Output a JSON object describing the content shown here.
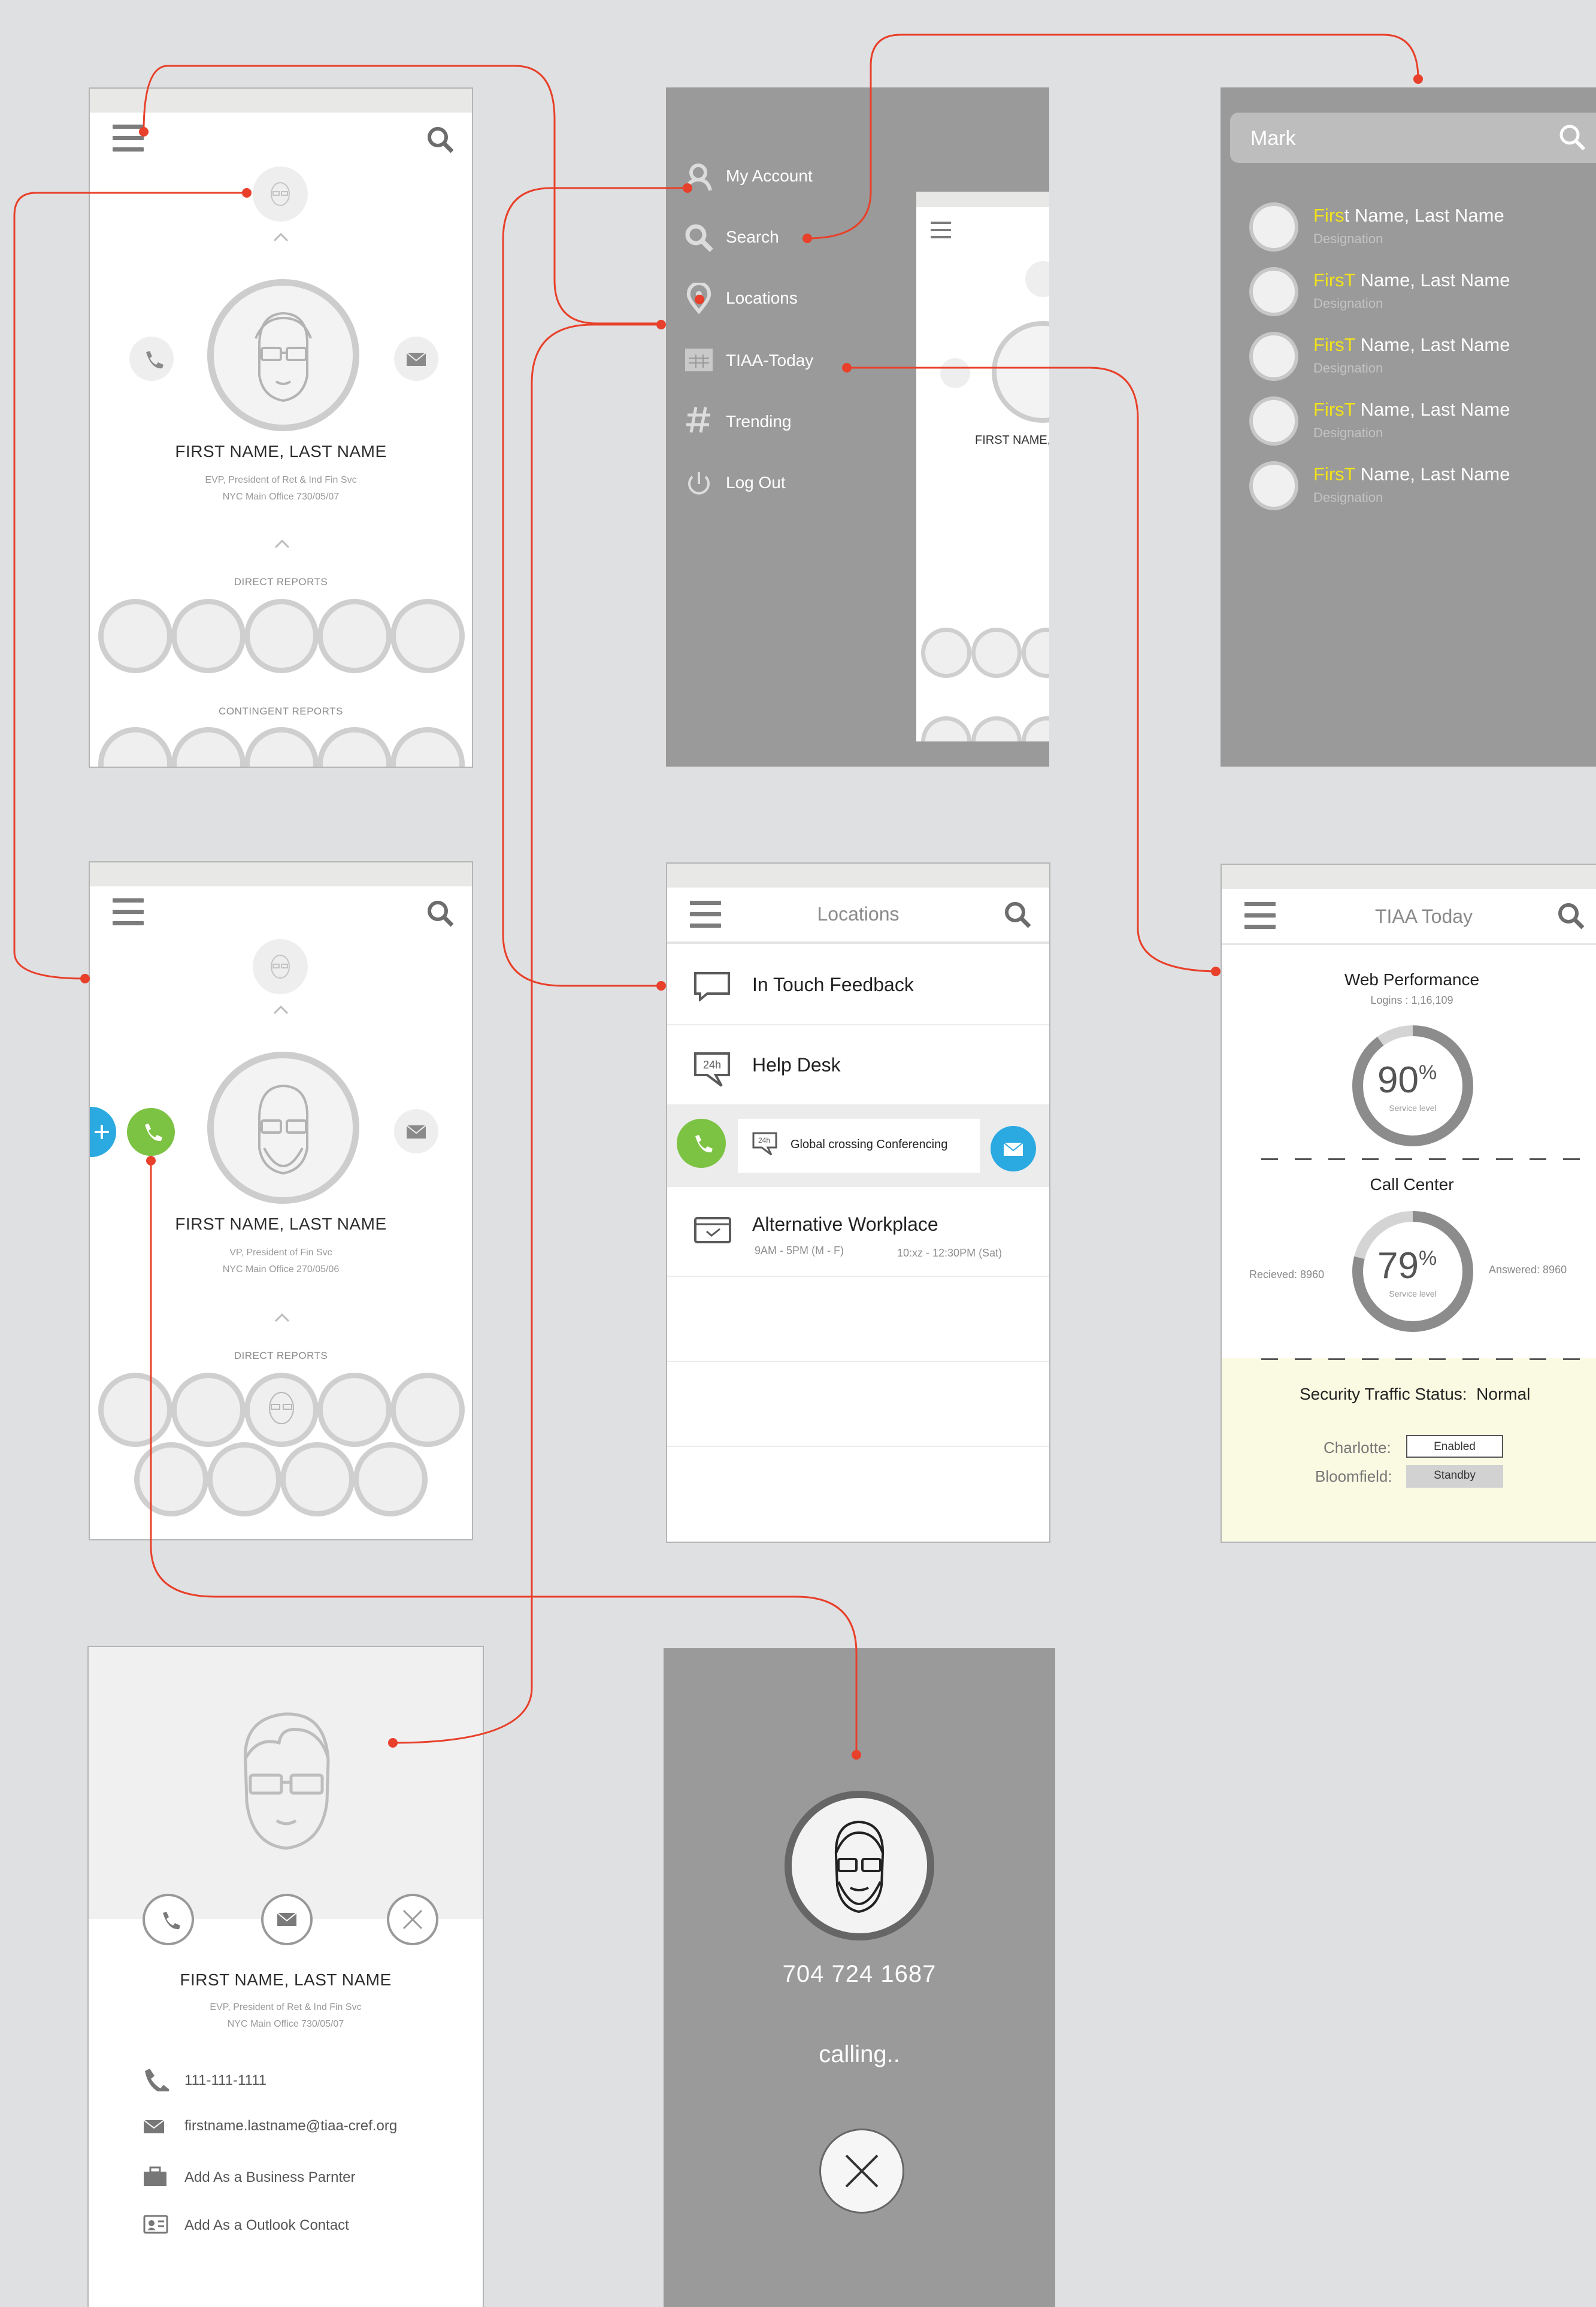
{
  "screen1": {
    "name": "FIRST NAME, LAST NAME",
    "title": "EVP, President of Ret & Ind Fin Svc",
    "office": "NYC Main Office 730/05/07",
    "direct_reports": "DIRECT REPORTS",
    "contingent_reports": "CONTINGENT REPORTS"
  },
  "menu": {
    "items": [
      {
        "label": "My Account",
        "icon": "user-icon"
      },
      {
        "label": "Search",
        "icon": "search-icon"
      },
      {
        "label": "Locations",
        "icon": "location-pin-icon"
      },
      {
        "label": "TIAA-Today",
        "icon": "calendar-icon"
      },
      {
        "label": "Trending",
        "icon": "hashtag-icon"
      },
      {
        "label": "Log Out",
        "icon": "power-icon"
      }
    ],
    "peek_name": "FIRST NAME,"
  },
  "search": {
    "query": "Mark",
    "results": [
      {
        "hl": "Firs",
        "rest": "t Name, Last Name",
        "designation": "Designation"
      },
      {
        "hl": "FirsT",
        "rest": " Name, Last Name",
        "designation": "Designation"
      },
      {
        "hl": "FirsT",
        "rest": " Name, Last Name",
        "designation": "Designation"
      },
      {
        "hl": "FirsT",
        "rest": " Name, Last Name",
        "designation": "Designation"
      },
      {
        "hl": "FirsT",
        "rest": " Name, Last Name",
        "designation": "Designation"
      }
    ]
  },
  "screen2": {
    "name": "FIRST NAME, LAST NAME",
    "title": "VP, President of Fin Svc",
    "office": "NYC Main Office 270/05/06",
    "direct_reports": "DIRECT REPORTS"
  },
  "locations": {
    "header": "Locations",
    "rows": [
      {
        "label": "In Touch Feedback"
      },
      {
        "label": "Help Desk"
      }
    ],
    "swipe_label": "Global crossing Conferencing",
    "alt": {
      "label": "Alternative Workplace",
      "hours1": "9AM - 5PM (M - F)",
      "hours2": "10:xz - 12:30PM (Sat)"
    }
  },
  "tiaa": {
    "header": "TIAA Today",
    "web_title": "Web Performance",
    "logins": "Logins : 1,16,109",
    "web_value": "90",
    "pct": "%",
    "service_level": "Service level",
    "call_title": "Call Center",
    "received": "Recieved: 8960",
    "answered": "Answered: 8960",
    "call_value": "79",
    "security_label": "Security Traffic Status:",
    "security_status": "Normal",
    "charlotte_label": "Charlotte:",
    "charlotte_status": "Enabled",
    "bloomfield_label": "Bloomfield:",
    "bloomfield_status": "Standby",
    "web_fraction": 0.9,
    "call_fraction": 0.79
  },
  "detail": {
    "name": "FIRST NAME, LAST NAME",
    "title": "EVP, President of Ret & Ind Fin Svc",
    "office": "NYC Main Office 730/05/07",
    "phone": "111-111-1111",
    "email": "firstname.lastname@tiaa-cref.org",
    "add_business": "Add As a Business Parnter",
    "add_outlook": "Add As a Outlook Contact"
  },
  "calling": {
    "number": "704 724 1687",
    "status": "calling.."
  },
  "colors": {
    "accent_red": "#e8402a",
    "green": "#7cc243",
    "blue": "#2ba9e1",
    "highlight_yellow": "#f1e21a",
    "panel_gray": "#9a9a9a"
  }
}
